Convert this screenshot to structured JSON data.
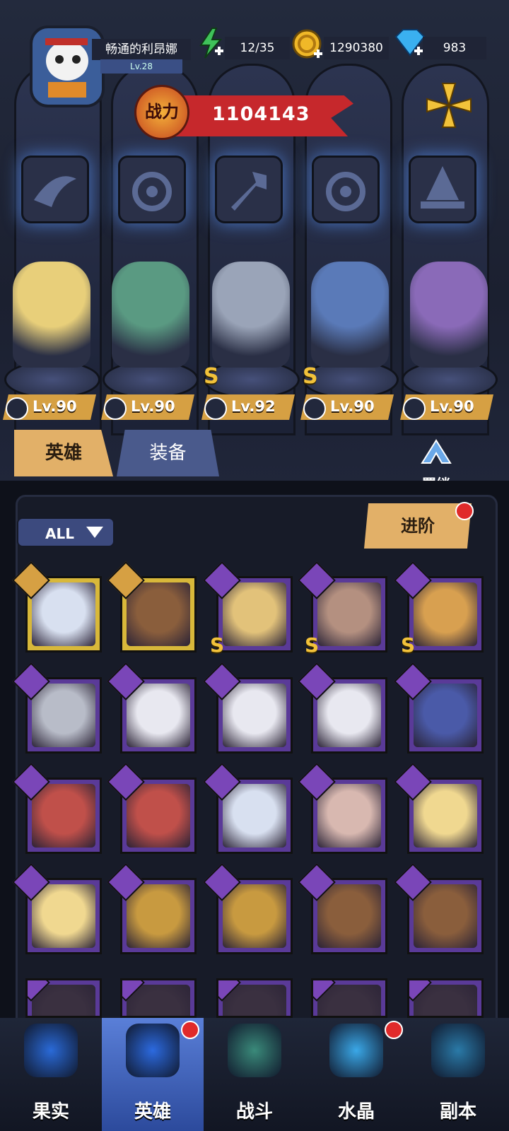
{
  "player": {
    "name": "畅通的利昂娜",
    "level": "Lv.28"
  },
  "resources": {
    "energy": "12/35",
    "gold": "1290380",
    "diamond": "983"
  },
  "power": {
    "badge": "战力",
    "value": "1104143"
  },
  "lineup": [
    {
      "level": "Lv.90",
      "class_icon": "wing-icon",
      "s_rank": false,
      "color": "#e8cf7a"
    },
    {
      "level": "Lv.90",
      "class_icon": "beast-icon",
      "s_rank": false,
      "color": "#5a9a82"
    },
    {
      "level": "Lv.92",
      "class_icon": "wrench-icon",
      "s_rank": true,
      "color": "#9aa4b8"
    },
    {
      "level": "Lv.90",
      "class_icon": "beast-icon",
      "s_rank": true,
      "color": "#5a7ab8"
    },
    {
      "level": "Lv.90",
      "class_icon": "witch-hat-icon",
      "s_rank": false,
      "color": "#8a6ab8"
    }
  ],
  "tabs": {
    "hero": "英雄",
    "equipment": "装备",
    "bond": "羁绊"
  },
  "filter": {
    "label": "ALL"
  },
  "advance": {
    "label": "进阶"
  },
  "roster": [
    [
      {
        "frame": "gold",
        "cls": "gold",
        "s": false,
        "color": "#d8e0f0"
      },
      {
        "frame": "gold",
        "cls": "gold",
        "s": false,
        "color": "#8a5e3c"
      },
      {
        "frame": "purple",
        "cls": "purple",
        "s": true,
        "color": "#e2c27a"
      },
      {
        "frame": "purple",
        "cls": "purple",
        "s": true,
        "color": "#b49080"
      },
      {
        "frame": "purple",
        "cls": "purple",
        "s": true,
        "color": "#d8a050"
      }
    ],
    [
      {
        "frame": "purple",
        "cls": "purple",
        "s": false,
        "color": "#b8bcc8"
      },
      {
        "frame": "purple",
        "cls": "purple",
        "s": false,
        "color": "#e8e8f0"
      },
      {
        "frame": "purple",
        "cls": "purple",
        "s": false,
        "color": "#e8e8f0"
      },
      {
        "frame": "purple",
        "cls": "purple",
        "s": false,
        "color": "#e8e8f0"
      },
      {
        "frame": "purple",
        "cls": "purple",
        "s": false,
        "color": "#4a5aa8"
      }
    ],
    [
      {
        "frame": "purple",
        "cls": "purple",
        "s": false,
        "color": "#c0504a"
      },
      {
        "frame": "purple",
        "cls": "purple",
        "s": false,
        "color": "#c0504a"
      },
      {
        "frame": "purple",
        "cls": "purple",
        "s": false,
        "color": "#d8e0f0"
      },
      {
        "frame": "purple",
        "cls": "purple",
        "s": false,
        "color": "#d8b8b0"
      },
      {
        "frame": "purple",
        "cls": "purple",
        "s": false,
        "color": "#f0d890"
      }
    ],
    [
      {
        "frame": "purple",
        "cls": "purple",
        "s": false,
        "color": "#f0d890"
      },
      {
        "frame": "purple",
        "cls": "purple",
        "s": false,
        "color": "#c89a40"
      },
      {
        "frame": "purple",
        "cls": "purple",
        "s": false,
        "color": "#c89a40"
      },
      {
        "frame": "purple",
        "cls": "purple",
        "s": false,
        "color": "#8a5e3c"
      },
      {
        "frame": "purple",
        "cls": "purple",
        "s": false,
        "color": "#8a5e3c"
      }
    ],
    [
      {
        "frame": "purple",
        "cls": "purple",
        "s": false,
        "color": "#3a3040"
      },
      {
        "frame": "purple",
        "cls": "purple",
        "s": false,
        "color": "#3a3040"
      },
      {
        "frame": "purple",
        "cls": "purple",
        "s": false,
        "color": "#3a3040"
      },
      {
        "frame": "purple",
        "cls": "purple",
        "s": false,
        "color": "#3a3040"
      },
      {
        "frame": "purple",
        "cls": "purple",
        "s": false,
        "color": "#3a3040"
      }
    ]
  ],
  "nav": [
    {
      "label": "果实",
      "icon": "fruit-icon",
      "active": false,
      "dot": false
    },
    {
      "label": "英雄",
      "icon": "hero-hat-icon",
      "active": true,
      "dot": true
    },
    {
      "label": "战斗",
      "icon": "battle-icon",
      "active": false,
      "dot": false
    },
    {
      "label": "水晶",
      "icon": "crystal-icon",
      "active": false,
      "dot": true
    },
    {
      "label": "副本",
      "icon": "dungeon-icon",
      "active": false,
      "dot": false
    }
  ]
}
